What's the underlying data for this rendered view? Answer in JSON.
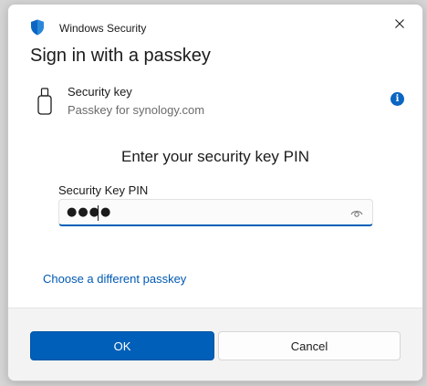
{
  "window": {
    "app_name": "Windows Security",
    "heading": "Sign in with a passkey"
  },
  "security_key": {
    "title": "Security key",
    "subtitle": "Passkey for synology.com",
    "info_icon": "i"
  },
  "pin": {
    "prompt": "Enter your security key PIN",
    "label": "Security Key PIN",
    "masked_value": "●●●●"
  },
  "links": {
    "choose_different": "Choose a different passkey"
  },
  "buttons": {
    "ok": "OK",
    "cancel": "Cancel"
  },
  "icons": {
    "app": "shield-icon",
    "close": "close-icon",
    "key": "usb-key-icon",
    "info": "info-icon",
    "reveal": "eye-icon"
  },
  "colors": {
    "accent": "#005fb8",
    "link": "#0059b3",
    "info": "#0a66c2"
  }
}
